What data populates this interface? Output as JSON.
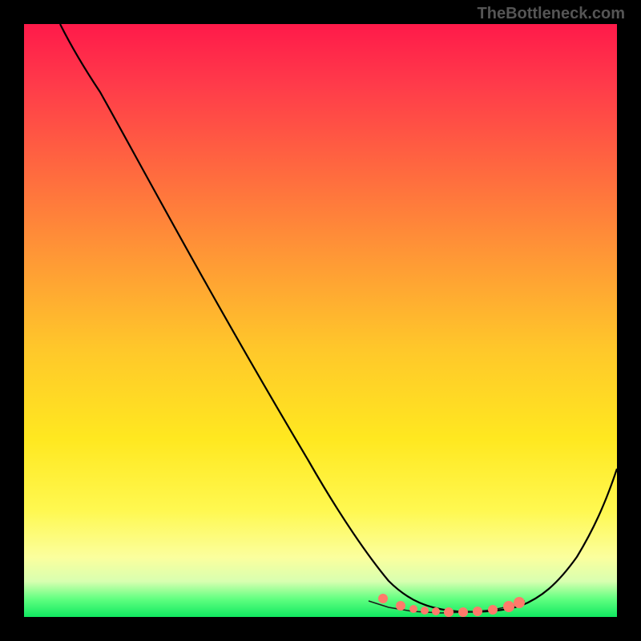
{
  "watermark": "TheBottleneck.com",
  "chart_data": {
    "type": "line",
    "title": "",
    "xlabel": "",
    "ylabel": "",
    "xlim": [
      0,
      100
    ],
    "ylim": [
      0,
      100
    ],
    "series": [
      {
        "name": "bottleneck-curve",
        "x": [
          0,
          5,
          10,
          15,
          20,
          25,
          30,
          35,
          40,
          45,
          50,
          55,
          58,
          62,
          66,
          70,
          74,
          78,
          82,
          86,
          90,
          95,
          100
        ],
        "y": [
          100,
          97,
          93,
          87,
          80,
          73,
          65,
          57,
          49,
          41,
          33,
          25,
          18,
          10,
          5,
          2,
          0.5,
          0.5,
          1,
          3,
          8,
          18,
          33
        ]
      }
    ],
    "markers": {
      "name": "optimal-range",
      "x": [
        60,
        64,
        66,
        68,
        70,
        72,
        74,
        76,
        79,
        82,
        83
      ],
      "y": [
        6,
        3,
        2.5,
        2,
        1.5,
        1,
        1,
        1,
        1.5,
        2.5,
        3
      ]
    },
    "annotations": []
  }
}
